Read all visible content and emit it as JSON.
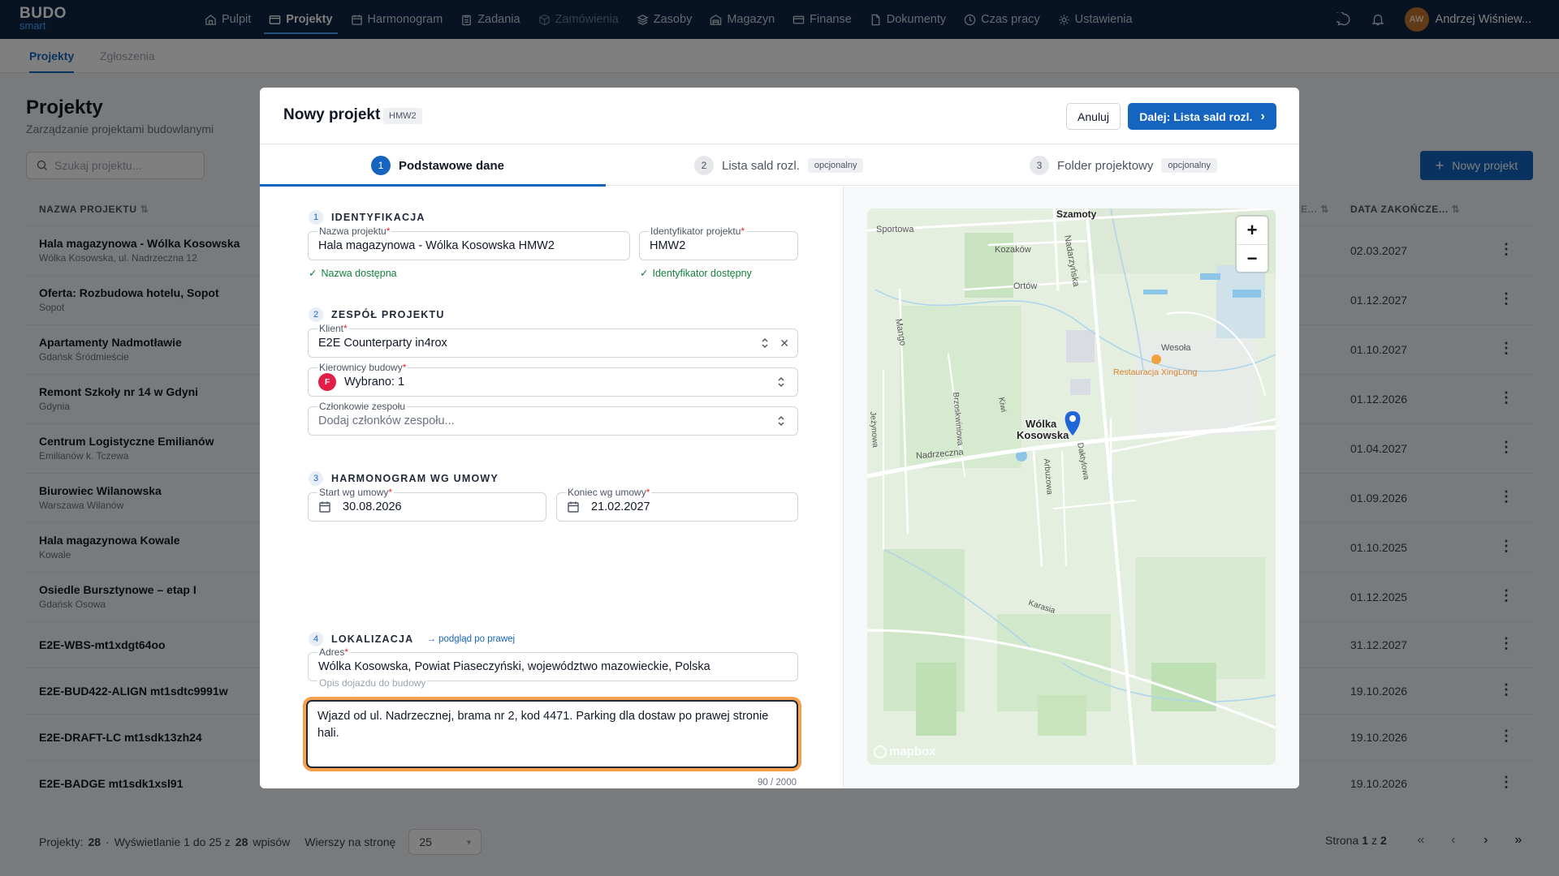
{
  "nav": {
    "logo_line1": "BUDO",
    "logo_line2": "smart",
    "items": [
      {
        "label": "Pulpit"
      },
      {
        "label": "Projekty"
      },
      {
        "label": "Harmonogram"
      },
      {
        "label": "Zadania"
      },
      {
        "label": "Zamówienia"
      },
      {
        "label": "Zasoby"
      },
      {
        "label": "Magazyn"
      },
      {
        "label": "Finanse"
      },
      {
        "label": "Dokumenty"
      },
      {
        "label": "Czas pracy"
      },
      {
        "label": "Ustawienia"
      }
    ],
    "user_initials": "AW",
    "user_name": "Andrzej Wiśniew..."
  },
  "subtabs": [
    "Projekty",
    "Zgłoszenia"
  ],
  "page": {
    "title": "Projekty",
    "subtitle": "Zarządzanie projektami budowlanymi",
    "search_placeholder": "Szukaj projektu...",
    "new_button": "Nowy projekt",
    "col_name": "NAZWA PROJEKTU",
    "col_end": "DATA ZAKOŃCZE...",
    "col_hidden": "E...",
    "rows": [
      {
        "name": "Hala magazynowa - Wólka Kosowska",
        "loc": "Wólka Kosowska, ul. Nadrzeczna 12",
        "date": "02.03.2027"
      },
      {
        "name": "Oferta: Rozbudowa hotelu, Sopot",
        "loc": "Sopot",
        "date": "01.12.2027"
      },
      {
        "name": "Apartamenty Nadmotławie",
        "loc": "Gdańsk Śródmieście",
        "date": "01.10.2027"
      },
      {
        "name": "Remont Szkoły nr 14 w Gdyni",
        "loc": "Gdynia",
        "date": "01.12.2026"
      },
      {
        "name": "Centrum Logistyczne Emilianów",
        "loc": "Emilianów k. Tczewa",
        "date": "01.04.2027"
      },
      {
        "name": "Biurowiec Wilanowska",
        "loc": "Warszawa Wilanów",
        "date": "01.09.2026"
      },
      {
        "name": "Hala magazynowa Kowale",
        "loc": "Kowale",
        "date": "01.10.2025"
      },
      {
        "name": "Osiedle Bursztynowe – etap I",
        "loc": "Gdańsk Osowa",
        "date": "01.12.2025"
      },
      {
        "name": "E2E-WBS-mt1xdgt64oo",
        "loc": "",
        "date": "31.12.2027"
      },
      {
        "name": "E2E-BUD422-ALIGN mt1sdtc9991w",
        "loc": "",
        "date": "19.10.2026"
      },
      {
        "name": "E2E-DRAFT-LC mt1sdk13zh24",
        "loc": "",
        "date": "19.10.2026"
      },
      {
        "name": "E2E-BADGE mt1sdk1xsl91",
        "loc": "",
        "date": "19.10.2026"
      }
    ],
    "footer": {
      "projects_label": "Projekty:",
      "projects_count": "28",
      "showing": "Wyświetlanie 1 do 25 z",
      "total": "28",
      "entries": "wpisów",
      "rows_label": "Wierszy na stronę",
      "rows_value": "25",
      "page_label": "Strona",
      "page_current": "1",
      "page_of": "z",
      "page_total": "2"
    }
  },
  "modal": {
    "title": "Nowy projekt",
    "badge": "HMW2",
    "cancel": "Anuluj",
    "next": "Dalej: Lista sald rozl.",
    "steps": [
      {
        "num": "1",
        "label": "Podstawowe dane",
        "opt": ""
      },
      {
        "num": "2",
        "label": "Lista sald rozl.",
        "opt": "opcjonalny"
      },
      {
        "num": "3",
        "label": "Folder projektowy",
        "opt": "opcjonalny"
      }
    ],
    "sec1": {
      "num": "1",
      "title": "IDENTYFIKACJA"
    },
    "name_label": "Nazwa projektu",
    "name_value": "Hala magazynowa - Wólka Kosowska HMW2",
    "name_valid": "Nazwa dostępna",
    "id_label": "Identyfikator projektu",
    "id_value": "HMW2",
    "id_valid": "Identyfikator dostępny",
    "sec2": {
      "num": "2",
      "title": "ZESPÓŁ PROJEKTU"
    },
    "client_label": "Klient",
    "client_value": "E2E Counterparty in4rox",
    "managers_label": "Kierownicy budowy",
    "managers_dot": "F",
    "managers_value": "Wybrano: 1",
    "members_label": "Członkowie zespołu",
    "members_placeholder": "Dodaj członków zespołu...",
    "sec3": {
      "num": "3",
      "title": "HARMONOGRAM WG UMOWY"
    },
    "start_label": "Start wg umowy",
    "start_value": "30.08.2026",
    "end_label": "Koniec wg umowy",
    "end_value": "21.02.2027",
    "sec4": {
      "num": "4",
      "title": "LOKALIZACJA",
      "hint": "→ podgląd po prawej"
    },
    "address_label": "Adres",
    "address_value": "Wólka Kosowska, Powiat Piaseczyński, województwo mazowieckie, Polska",
    "directions_label": "Opis dojazdu do budowy",
    "directions_value": "Wjazd od ul. Nadrzecznej, brama nr 2, kod 4471. Parking dla dostaw po prawej stronie hali.",
    "counter": "90 / 2000"
  },
  "map": {
    "labels": [
      "Sportowa",
      "Szamoty",
      "Kozaków",
      "Nadarzyńska",
      "Ortów",
      "Mango",
      "Wesoła",
      "Restauracja XingLong",
      "Brzoskwiniowa",
      "Kiwi",
      "Jeżynowa",
      "Wólka",
      "Kosowska",
      "Nadrzeczna",
      "Daktylowa",
      "Arbuzowa",
      "Karasia"
    ],
    "zoom_in": "+",
    "zoom_out": "−",
    "attribution": "mapbox"
  }
}
